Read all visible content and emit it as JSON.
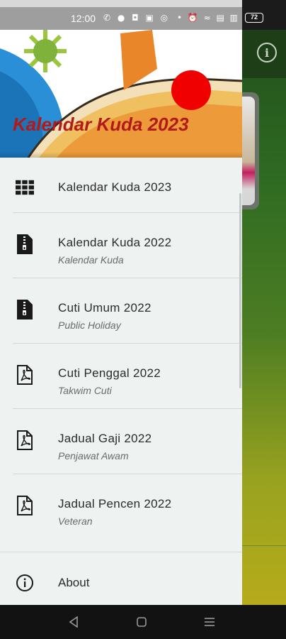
{
  "status_bar": {
    "time": "12:00",
    "left_icons": "✆ ● ◘ ▣ ◎",
    "right_icons": "• ⏰ ≈ ▤ ▥",
    "battery": "72"
  },
  "drawer": {
    "header_title": "Kalendar Kuda 2023",
    "items": [
      {
        "label": "Kalendar Kuda 2023",
        "subtitle": "",
        "icon": "grid-icon"
      },
      {
        "label": "Kalendar Kuda 2022",
        "subtitle": "Kalendar Kuda",
        "icon": "zip-file-icon"
      },
      {
        "label": "Cuti Umum 2022",
        "subtitle": "Public Holiday",
        "icon": "zip-file-icon"
      },
      {
        "label": "Cuti Penggal 2022",
        "subtitle": "Takwim Cuti",
        "icon": "pdf-file-icon"
      },
      {
        "label": "Jadual Gaji 2022",
        "subtitle": "Penjawat Awam",
        "icon": "pdf-file-icon"
      },
      {
        "label": "Jadual Pencen 2022",
        "subtitle": "Veteran",
        "icon": "pdf-file-icon"
      }
    ],
    "about_label": "About"
  },
  "background_app": {
    "info_icon": "i"
  },
  "colors": {
    "header_title": "#b21a1a",
    "drawer_bg": "#eef2f1",
    "appbar": "#1d3e17"
  }
}
